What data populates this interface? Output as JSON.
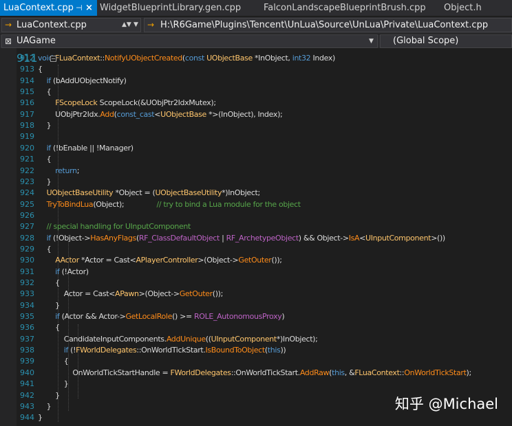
{
  "tabs": [
    {
      "label": "LuaContext.cpp",
      "active": true,
      "pin": "⊣",
      "close": "×"
    },
    {
      "label": "WidgetBlueprintLibrary.gen.cpp",
      "active": false
    },
    {
      "label": "FalconLandscapeBlueprintBrush.cpp",
      "active": false
    },
    {
      "label": "Object.h",
      "active": false
    }
  ],
  "navbar": {
    "file_combo": {
      "icon": "→",
      "value": "LuaContext.cpp"
    },
    "path_combo": {
      "icon": "→",
      "value": "H:\\R6Game\\Plugins\\Tencent\\UnLua\\Source\\UnLua\\Private\\LuaContext.cpp"
    }
  },
  "scopebar": {
    "project_combo": {
      "icon": "⊠",
      "value": "UAGame"
    },
    "scope_combo": {
      "value": "(Global Scope)"
    }
  },
  "editor": {
    "partial_top_line": "911",
    "lines": [
      {
        "n": "912",
        "segs": [
          [
            "void",
            "kw"
          ],
          [
            " ",
            "pl"
          ],
          [
            "FLuaContext",
            "ty"
          ],
          [
            "::",
            "pl"
          ],
          [
            "NotifyUObjectCreated",
            "fn"
          ],
          [
            "(",
            "pl"
          ],
          [
            "const",
            "kw"
          ],
          [
            " ",
            "pl"
          ],
          [
            "UObjectBase",
            "ty"
          ],
          [
            " *InObject, ",
            "pl"
          ],
          [
            "int32",
            "kw"
          ],
          [
            " Index)",
            "pl"
          ]
        ]
      },
      {
        "n": "913",
        "segs": [
          [
            "{",
            "pl"
          ]
        ]
      },
      {
        "n": "914",
        "segs": [
          [
            "    ",
            "pl"
          ],
          [
            "if",
            "kw"
          ],
          [
            " (bAddUObjectNotify)",
            "pl"
          ]
        ]
      },
      {
        "n": "915",
        "segs": [
          [
            "    {",
            "pl"
          ]
        ]
      },
      {
        "n": "916",
        "segs": [
          [
            "        ",
            "pl"
          ],
          [
            "FScopeLock",
            "ty"
          ],
          [
            " ScopeLock(&UObjPtr2IdxMutex);",
            "pl"
          ]
        ]
      },
      {
        "n": "917",
        "segs": [
          [
            "        UObjPtr2Idx.",
            "pl"
          ],
          [
            "Add",
            "fn"
          ],
          [
            "(",
            "pl"
          ],
          [
            "const_cast",
            "kw"
          ],
          [
            "<",
            "pl"
          ],
          [
            "UObjectBase",
            "ty"
          ],
          [
            " *>(InObject), Index);",
            "pl"
          ]
        ]
      },
      {
        "n": "918",
        "segs": [
          [
            "    }",
            "pl"
          ]
        ]
      },
      {
        "n": "919",
        "segs": []
      },
      {
        "n": "920",
        "segs": [
          [
            "    ",
            "pl"
          ],
          [
            "if",
            "kw"
          ],
          [
            " (!bEnable || !Manager)",
            "pl"
          ]
        ]
      },
      {
        "n": "921",
        "segs": [
          [
            "    {",
            "pl"
          ]
        ]
      },
      {
        "n": "922",
        "segs": [
          [
            "        ",
            "pl"
          ],
          [
            "return",
            "kw"
          ],
          [
            ";",
            "pl"
          ]
        ]
      },
      {
        "n": "923",
        "segs": [
          [
            "    }",
            "pl"
          ]
        ]
      },
      {
        "n": "924",
        "segs": [
          [
            "    ",
            "pl"
          ],
          [
            "UObjectBaseUtility",
            "ty"
          ],
          [
            " *Object = (",
            "pl"
          ],
          [
            "UObjectBaseUtility",
            "ty"
          ],
          [
            "*)InObject;",
            "pl"
          ]
        ]
      },
      {
        "n": "925",
        "segs": [
          [
            "    ",
            "pl"
          ],
          [
            "TryToBindLua",
            "fn"
          ],
          [
            "(Object);",
            "pl"
          ],
          [
            "               // try to bind a Lua module for the object",
            "cm"
          ]
        ]
      },
      {
        "n": "926",
        "segs": []
      },
      {
        "n": "927",
        "segs": [
          [
            "    ",
            "pl"
          ],
          [
            "// special handling for UInputComponent",
            "cm"
          ]
        ]
      },
      {
        "n": "928",
        "segs": [
          [
            "    ",
            "pl"
          ],
          [
            "if",
            "kw"
          ],
          [
            " (!Object->",
            "pl"
          ],
          [
            "HasAnyFlags",
            "fn"
          ],
          [
            "(",
            "pl"
          ],
          [
            "RF_ClassDefaultObject",
            "mac"
          ],
          [
            " | ",
            "pl"
          ],
          [
            "RF_ArchetypeObject",
            "mac"
          ],
          [
            ") && Object->",
            "pl"
          ],
          [
            "IsA",
            "fn"
          ],
          [
            "<",
            "pl"
          ],
          [
            "UInputComponent",
            "ty"
          ],
          [
            ">())",
            "pl"
          ]
        ]
      },
      {
        "n": "929",
        "segs": [
          [
            "    {",
            "pl"
          ]
        ]
      },
      {
        "n": "930",
        "segs": [
          [
            "        ",
            "pl"
          ],
          [
            "AActor",
            "ty"
          ],
          [
            " *Actor = Cast<",
            "pl"
          ],
          [
            "APlayerController",
            "ty"
          ],
          [
            ">(Object->",
            "pl"
          ],
          [
            "GetOuter",
            "fn"
          ],
          [
            "());",
            "pl"
          ]
        ]
      },
      {
        "n": "931",
        "segs": [
          [
            "        ",
            "pl"
          ],
          [
            "if",
            "kw"
          ],
          [
            " (!Actor)",
            "pl"
          ]
        ]
      },
      {
        "n": "932",
        "segs": [
          [
            "        {",
            "pl"
          ]
        ]
      },
      {
        "n": "933",
        "segs": [
          [
            "            Actor = Cast<",
            "pl"
          ],
          [
            "APawn",
            "ty"
          ],
          [
            ">(Object->",
            "pl"
          ],
          [
            "GetOuter",
            "fn"
          ],
          [
            "());",
            "pl"
          ]
        ]
      },
      {
        "n": "934",
        "segs": [
          [
            "        }",
            "pl"
          ]
        ]
      },
      {
        "n": "935",
        "segs": [
          [
            "        ",
            "pl"
          ],
          [
            "if",
            "kw"
          ],
          [
            " (Actor && Actor->",
            "pl"
          ],
          [
            "GetLocalRole",
            "fn"
          ],
          [
            "() >= ",
            "pl"
          ],
          [
            "ROLE_AutonomousProxy",
            "mac"
          ],
          [
            ")",
            "pl"
          ]
        ]
      },
      {
        "n": "936",
        "segs": [
          [
            "        {",
            "pl"
          ]
        ]
      },
      {
        "n": "937",
        "segs": [
          [
            "            CandidateInputComponents.",
            "pl"
          ],
          [
            "AddUnique",
            "fn"
          ],
          [
            "((",
            "pl"
          ],
          [
            "UInputComponent",
            "ty"
          ],
          [
            "*)InObject);",
            "pl"
          ]
        ]
      },
      {
        "n": "938",
        "segs": [
          [
            "            ",
            "pl"
          ],
          [
            "if",
            "kw"
          ],
          [
            " (!",
            "pl"
          ],
          [
            "FWorldDelegates",
            "ty"
          ],
          [
            "::OnWorldTickStart.",
            "pl"
          ],
          [
            "IsBoundToObject",
            "fn"
          ],
          [
            "(",
            "pl"
          ],
          [
            "this",
            "kw"
          ],
          [
            "))",
            "pl"
          ]
        ]
      },
      {
        "n": "939",
        "segs": [
          [
            "            {",
            "pl"
          ]
        ]
      },
      {
        "n": "940",
        "segs": [
          [
            "                OnWorldTickStartHandle = ",
            "pl"
          ],
          [
            "FWorldDelegates",
            "ty"
          ],
          [
            "::OnWorldTickStart.",
            "pl"
          ],
          [
            "AddRaw",
            "fn"
          ],
          [
            "(",
            "pl"
          ],
          [
            "this",
            "kw"
          ],
          [
            ", &",
            "pl"
          ],
          [
            "FLuaContext",
            "ty"
          ],
          [
            "::",
            "pl"
          ],
          [
            "OnWorldTickStart",
            "fn"
          ],
          [
            ");",
            "pl"
          ]
        ]
      },
      {
        "n": "941",
        "segs": [
          [
            "            }",
            "pl"
          ]
        ]
      },
      {
        "n": "942",
        "segs": [
          [
            "        }",
            "pl"
          ]
        ]
      },
      {
        "n": "943",
        "segs": [
          [
            "    }",
            "pl"
          ]
        ]
      },
      {
        "n": "944",
        "segs": [
          [
            "}",
            "pl"
          ]
        ]
      }
    ]
  },
  "watermark": "知乎 @Michael",
  "colors": {
    "tab_active": "#007acc",
    "keyword": "#569cd6",
    "type": "#ffc66d",
    "function": "#ff8c1a",
    "comment": "#57a64a",
    "macro": "#bd63c5",
    "line_number": "#2b91af"
  }
}
